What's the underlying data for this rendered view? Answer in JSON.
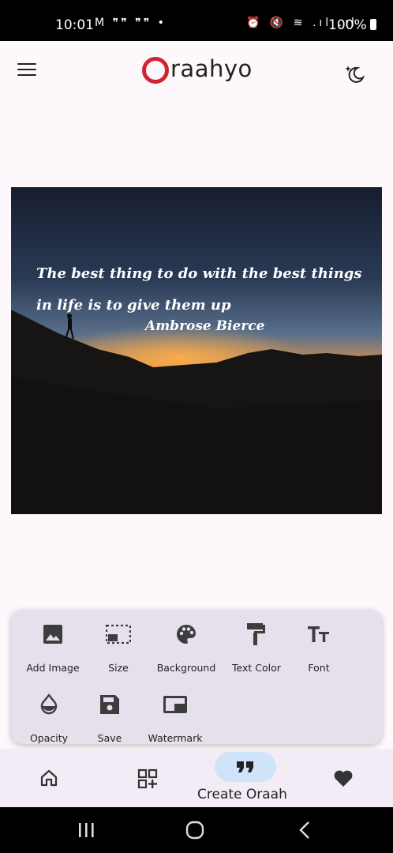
{
  "status_bar": {
    "time": "10:01",
    "notification_icons": "M ❞❞ ❞❞ •",
    "system_icons": "⏰ 🔇 ≋ .ıl .ıl",
    "battery": "100%"
  },
  "app_bar": {
    "logo_text": "raahyo",
    "logo_color": "#d32330",
    "menu_icon": "hamburger-menu-icon",
    "theme_icon": "moon-star-icon"
  },
  "canvas": {
    "quote": "The best thing to do with the best things in life is to give them up",
    "author": "Ambrose Bierce"
  },
  "tools": {
    "add_image": "Add Image",
    "size": "Size",
    "background": "Background",
    "text_color": "Text Color",
    "font": "Font",
    "opacity": "Opacity",
    "save": "Save",
    "watermark": "Watermark"
  },
  "bottom_nav": {
    "home_icon": "home-icon",
    "qr_icon": "qr-code-add-icon",
    "create_label": "Create Oraah",
    "favorite_icon": "heart-icon",
    "active_pill_color": "#cfe4f9"
  },
  "system_nav": {
    "recents": "recents-icon",
    "home": "home-circle-icon",
    "back": "back-icon"
  }
}
